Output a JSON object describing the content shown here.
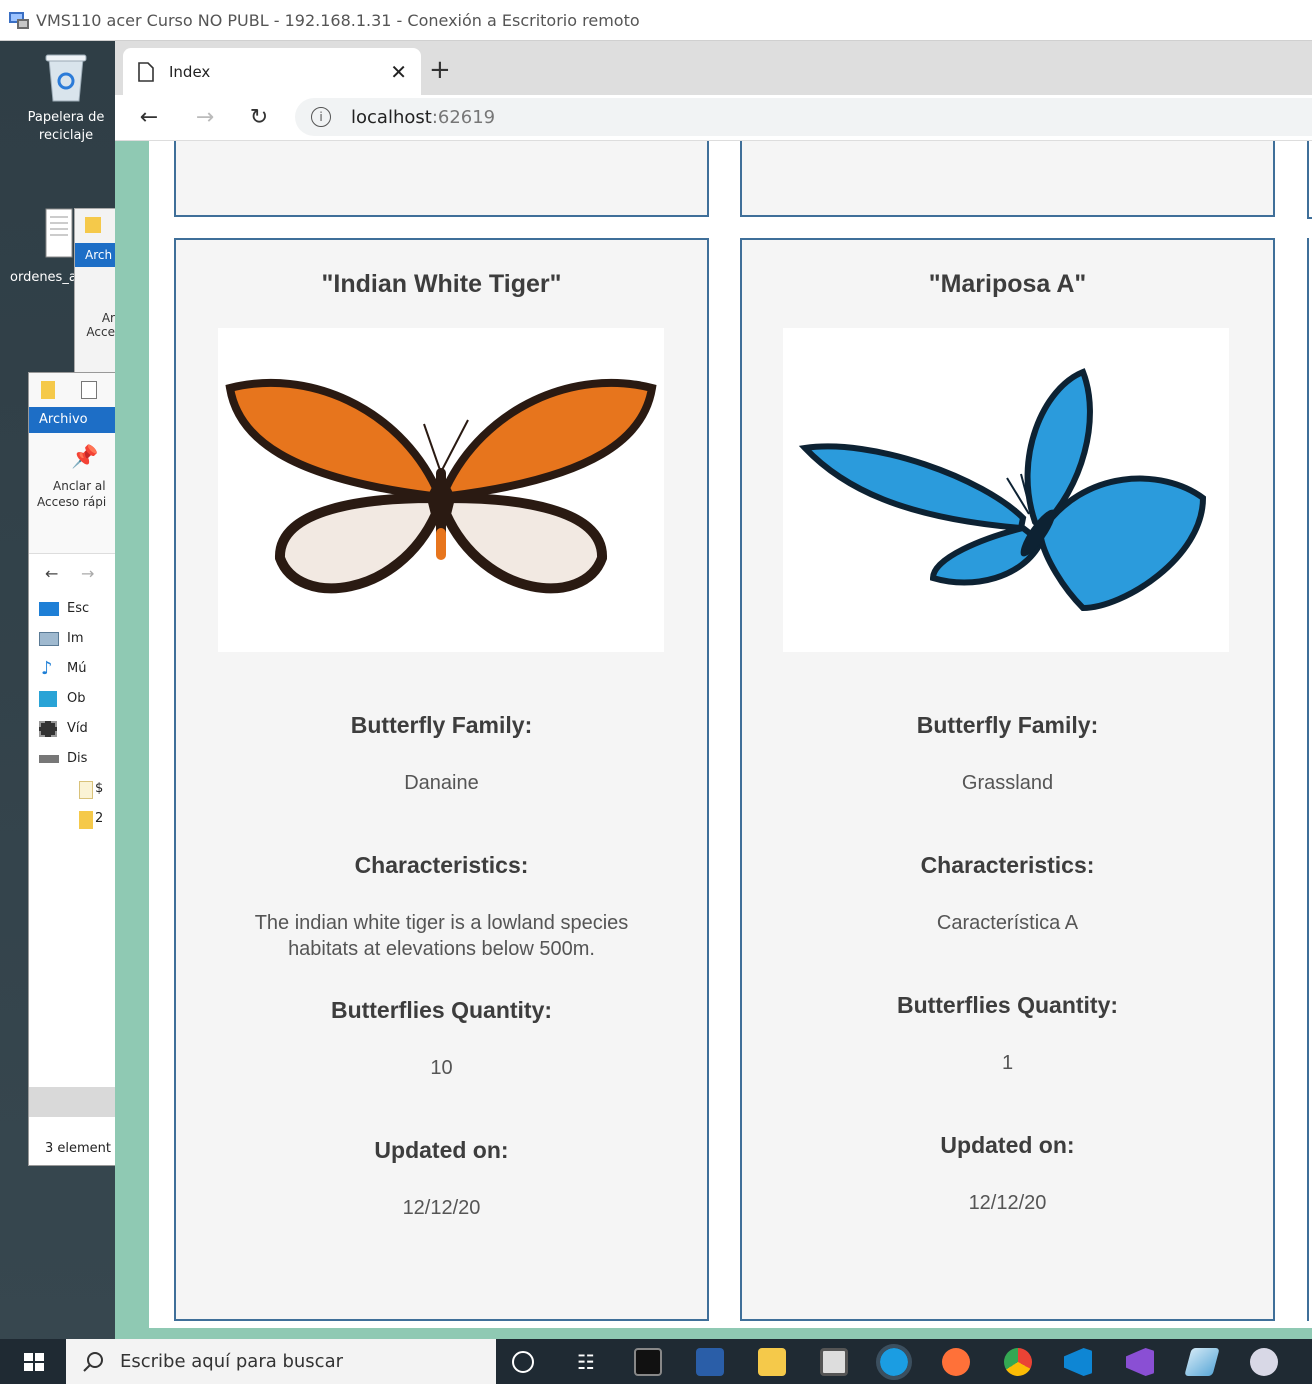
{
  "rdp_window": {
    "title": "VMS110 acer Curso NO PUBL - 192.168.1.31 - Conexión a Escritorio remoto"
  },
  "desktop": {
    "icons": [
      {
        "label_line1": "Papelera de",
        "label_line2": "reciclaje"
      },
      {
        "label": "ordenes_a"
      }
    ]
  },
  "explorer_back": {
    "ribbon_tab": "Arch",
    "item_a": "Ar",
    "item_b": "Acce"
  },
  "explorer": {
    "ribbon_tab": "Archivo",
    "pin_label_line1": "Anclar al",
    "pin_label_line2": "Acceso rápi",
    "tree_items": [
      "Esc",
      "Im",
      "Mú",
      "Ob",
      "Víd",
      "Dis",
      "$",
      "2"
    ],
    "status": "3 element"
  },
  "browser": {
    "tab_title": "Index",
    "url_host": "localhost",
    "url_port": ":62619"
  },
  "cards": [
    {
      "title": "\"Indian White Tiger\"",
      "family_label": "Butterfly Family:",
      "family": "Danaine",
      "characteristics_label": "Characteristics:",
      "characteristics_line1": "The indian white tiger is a lowland species",
      "characteristics_line2": "habitats at elevations below 500m.",
      "quantity_label": "Butterflies Quantity:",
      "quantity": "10",
      "updated_label": "Updated on:",
      "updated": "12/12/20"
    },
    {
      "title": "\"Mariposa A\"",
      "family_label": "Butterfly Family:",
      "family": "Grassland",
      "characteristics_label": "Characteristics:",
      "characteristics": "Característica A",
      "quantity_label": "Butterflies Quantity:",
      "quantity": "1",
      "updated_label": "Updated on:",
      "updated": "12/12/20"
    }
  ],
  "taskbar": {
    "search_placeholder": "Escribe aquí para buscar"
  },
  "colors": {
    "card_border": "#3f6f99",
    "card_bg": "#f5f5f5",
    "page_side": "#8fc9b3"
  }
}
